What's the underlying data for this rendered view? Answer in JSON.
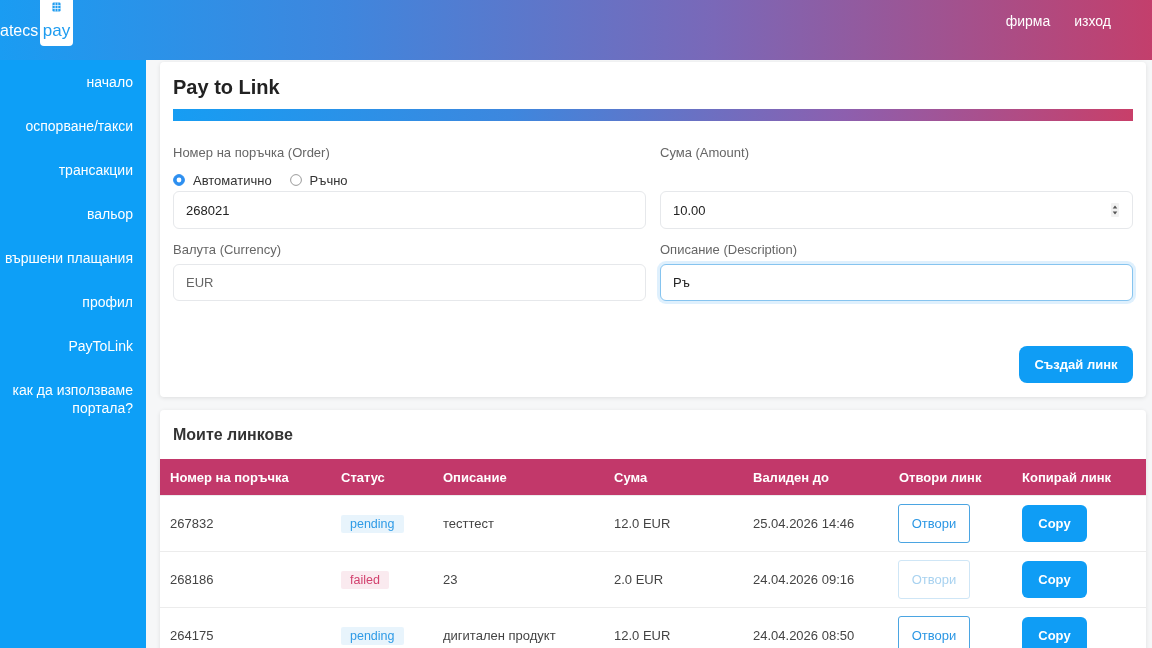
{
  "header": {
    "logo": {
      "wordmark": "atecs",
      "tile_text": "pay"
    },
    "links": [
      "фирма",
      "изход"
    ]
  },
  "sidebar": {
    "items": [
      "начало",
      "оспорване/такси",
      "трансакции",
      "вальор",
      "вършени плащания",
      "профил",
      "PayToLink",
      "как да използваме портала?"
    ]
  },
  "form": {
    "title": "Pay to Link",
    "order": {
      "label": "Номер на поръчка (Order)",
      "options": [
        {
          "label": "Автоматично",
          "selected": true
        },
        {
          "label": "Ръчно",
          "selected": false
        }
      ],
      "value": "268021",
      "disabled": false,
      "focused": false
    },
    "amount": {
      "label": "Сума (Amount)",
      "value": "10.00",
      "disabled": false,
      "focused": false
    },
    "currency": {
      "label": "Валута (Currency)",
      "value": "EUR",
      "disabled": true,
      "focused": false
    },
    "description": {
      "label": "Описание (Description)",
      "value": "Ръ",
      "disabled": false,
      "focused": true
    },
    "submit": "Създай линк"
  },
  "links": {
    "title": "Моите линкове",
    "columns": [
      "Номер на поръчка",
      "Статус",
      "Описание",
      "Сума",
      "Валиден до",
      "Отвори линк",
      "Копирай линк"
    ],
    "rows": [
      {
        "order": "267832",
        "status": {
          "label": "pending",
          "color": "#2f9be6"
        },
        "description": "тесттест",
        "amount": "12.0 EUR",
        "valid_until": "25.04.2026 14:46",
        "open": {
          "label": "Отвори",
          "disabled": false
        },
        "copy": "Copy"
      },
      {
        "order": "268186",
        "status": {
          "label": "failed",
          "color": "#d2416e"
        },
        "description": "23",
        "amount": "2.0 EUR",
        "valid_until": "24.04.2026 09:16",
        "open": {
          "label": "Отвори",
          "disabled": true
        },
        "copy": "Copy"
      },
      {
        "order": "264175",
        "status": {
          "label": "pending",
          "color": "#2f9be6"
        },
        "description": "дигитален продукт",
        "amount": "12.0 EUR",
        "valid_until": "24.04.2026 08:50",
        "open": {
          "label": "Отвори",
          "disabled": false
        },
        "copy": "Copy"
      }
    ]
  }
}
